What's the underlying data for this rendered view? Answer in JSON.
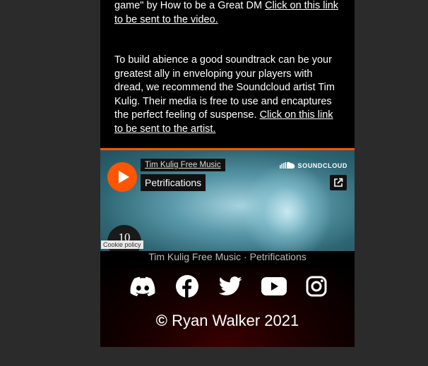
{
  "article": {
    "para1_text": "game\" by How to be a Great DM ",
    "para1_link": "Click on this link to be sent to the video.",
    "para2_text": "To build abience a good soundtrack can be your greatest ally in enveloping your players with dread, we recommend the Soundcloud artist Tim Kulig. Their media is free to use and encaptures the perfect feeling of suspense. ",
    "para2_link": "Click on this link to be sent to the artist."
  },
  "player": {
    "artist": "Tim Kulig Free Music",
    "track": "Petrifications",
    "brand": "SOUNDCLOUD",
    "count": "10",
    "cookie_policy": "Cookie policy",
    "caption": "Tim Kulig Free Music · Petrifications"
  },
  "footer": {
    "socials": [
      "discord-icon",
      "facebook-icon",
      "twitter-icon",
      "youtube-icon",
      "instagram-icon"
    ],
    "copyright_symbol": "©",
    "copyright_text": " Ryan Walker 2021"
  },
  "colors": {
    "accent": "#ff5500",
    "background": "#000000",
    "page": "#2b2b2b"
  }
}
